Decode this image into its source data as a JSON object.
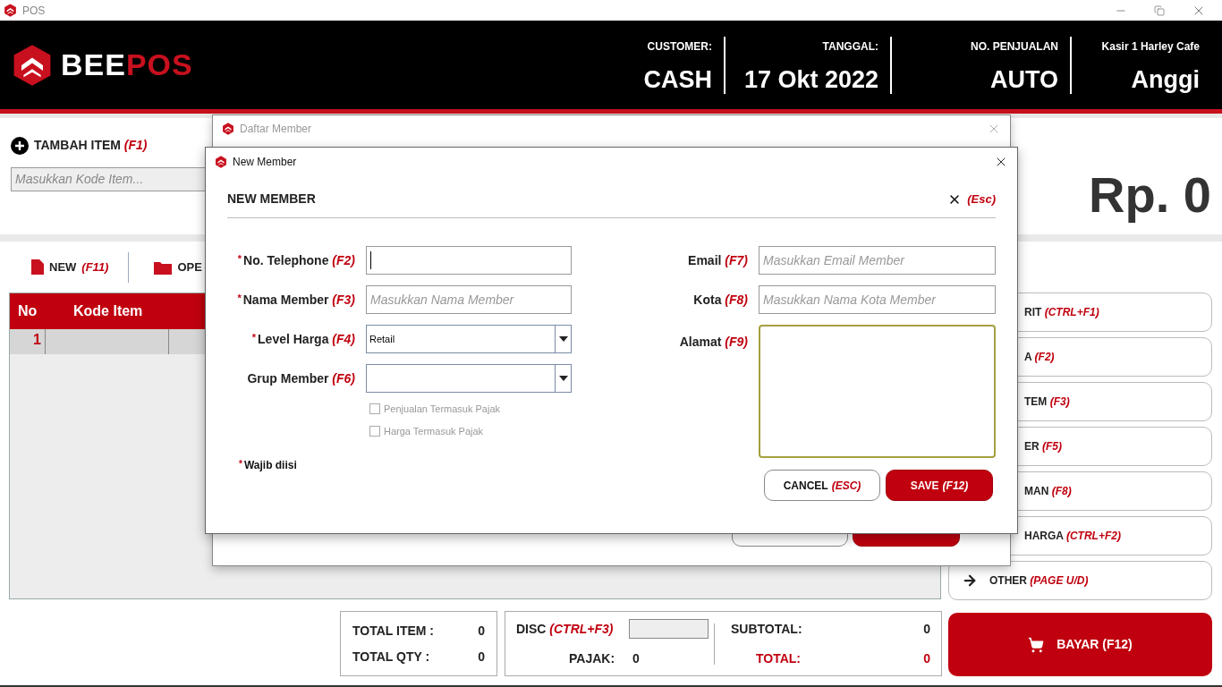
{
  "window": {
    "title": "POS"
  },
  "header": {
    "logo": {
      "first": "BEE",
      "second": "POS"
    },
    "fields": [
      {
        "label": "CUSTOMER:",
        "value": "CASH"
      },
      {
        "label": "TANGGAL:",
        "value": "17 Okt 2022"
      },
      {
        "label": "NO. PENJUALAN",
        "value": "AUTO"
      },
      {
        "label": "Kasir 1 Harley Cafe",
        "value": "Anggi"
      }
    ]
  },
  "item_entry": {
    "label": "TAMBAH ITEM",
    "shortcut": "(F1)",
    "placeholder": "Masukkan Kode Item..."
  },
  "grand_total": "Rp. 0",
  "toolbar": [
    {
      "kind": "file",
      "label": "NEW",
      "shortcut": "(F11)"
    },
    {
      "kind": "folder",
      "label": "OPE"
    }
  ],
  "table": {
    "columns": [
      "No",
      "Kode Item"
    ],
    "rows": [
      {
        "no": "1"
      }
    ]
  },
  "side_buttons": [
    {
      "kind": "plain",
      "label": "RIT",
      "shortcut": "(CTRL+F1)"
    },
    {
      "kind": "plain",
      "label": "A",
      "shortcut": "(F2)"
    },
    {
      "kind": "plain",
      "label": "TEM",
      "shortcut": "(F3)"
    },
    {
      "kind": "plain",
      "label": "ER",
      "shortcut": "(F5)"
    },
    {
      "kind": "plain",
      "label": "MAN",
      "shortcut": "(F8)"
    },
    {
      "kind": "plain",
      "label": "HARGA",
      "shortcut": "(CTRL+F2)"
    },
    {
      "kind": "arrow",
      "label": "OTHER",
      "shortcut": "(PAGE U/D)"
    }
  ],
  "summary": {
    "total_item": {
      "label": "TOTAL ITEM :",
      "value": "0"
    },
    "total_qty": {
      "label": "TOTAL QTY :",
      "value": "0"
    },
    "disc": {
      "label": "DISC",
      "shortcut": "(CTRL+F3)"
    },
    "pajak": {
      "label": "PAJAK:",
      "value": "0"
    },
    "subtotal": {
      "label": "SUBTOTAL:",
      "value": "0"
    },
    "total": {
      "label": "TOTAL:",
      "value": "0"
    }
  },
  "pay_button": {
    "label": "BAYAR (F12)"
  },
  "member_list_dialog": {
    "title": "Daftar Member",
    "buttons": [
      {
        "kind": "secondary"
      },
      {
        "kind": "primary"
      }
    ]
  },
  "new_member_dialog": {
    "title": "New Member",
    "heading": "NEW MEMBER",
    "close_shortcut": "(Esc)",
    "left_fields": [
      {
        "kind": "text",
        "mark": "*",
        "label": "No. Telephone",
        "shortcut": "(F2)",
        "focused": true
      },
      {
        "kind": "text",
        "mark": "*",
        "label": "Nama Member",
        "shortcut": "(F3)",
        "placeholder": "Masukkan Nama Member",
        "focused": false
      },
      {
        "kind": "select",
        "mark": "*",
        "label": "Level Harga",
        "shortcut": "(F4)",
        "value": "Retail"
      },
      {
        "kind": "select",
        "label": "Grup Member",
        "shortcut": "(F6)"
      }
    ],
    "checkboxes": [
      {
        "label": "Penjualan Termasuk Pajak",
        "checked": false,
        "disabled": true
      },
      {
        "label": "Harga Termasuk Pajak",
        "checked": false,
        "disabled": true
      }
    ],
    "required_note": {
      "mark": "*",
      "text": "Wajib diisi"
    },
    "right_fields": [
      {
        "kind": "text",
        "label": "Email",
        "shortcut": "(F7)",
        "placeholder": "Masukkan Email Member",
        "focused": false
      },
      {
        "kind": "text",
        "label": "Kota",
        "shortcut": "(F8)",
        "placeholder": "Masukkan Nama Kota Member",
        "focused": false
      },
      {
        "kind": "textarea",
        "label": "Alamat",
        "shortcut": "(F9)",
        "focused": true
      }
    ],
    "buttons": [
      {
        "kind": "secondary",
        "label": "CANCEL",
        "shortcut": "(ESC)"
      },
      {
        "kind": "primary",
        "label": "SAVE",
        "shortcut": "(F12)"
      }
    ]
  }
}
